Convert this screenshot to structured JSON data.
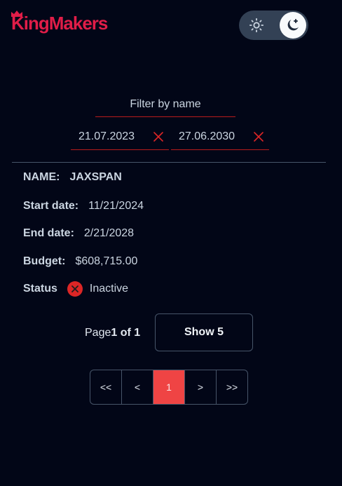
{
  "brand": {
    "logo_text": "KingMakers",
    "accent": "#e11d48"
  },
  "theme": {
    "light_icon": "sun-icon",
    "dark_icon": "moon-icon",
    "active": "dark"
  },
  "filters": {
    "name_placeholder": "Filter by name",
    "date_from": "21.07.2023",
    "date_to": "27.06.2030",
    "clear_icon": "close-icon"
  },
  "record": {
    "name_label": "NAME:",
    "name_value": "JAXSPAN",
    "start_label": "Start date:",
    "start_value": "11/21/2024",
    "end_label": "End date:",
    "end_value": "2/21/2028",
    "budget_label": "Budget:",
    "budget_value": "$608,715.00",
    "status_label": "Status",
    "status_value": "Inactive",
    "status_icon": "x-circle-icon",
    "status_color": "#dc2626"
  },
  "pagination": {
    "page_prefix": "Page",
    "page_of": "1 of 1",
    "show_label": "Show 5",
    "first": "<<",
    "prev": "<",
    "current": "1",
    "next": ">",
    "last": ">>"
  }
}
